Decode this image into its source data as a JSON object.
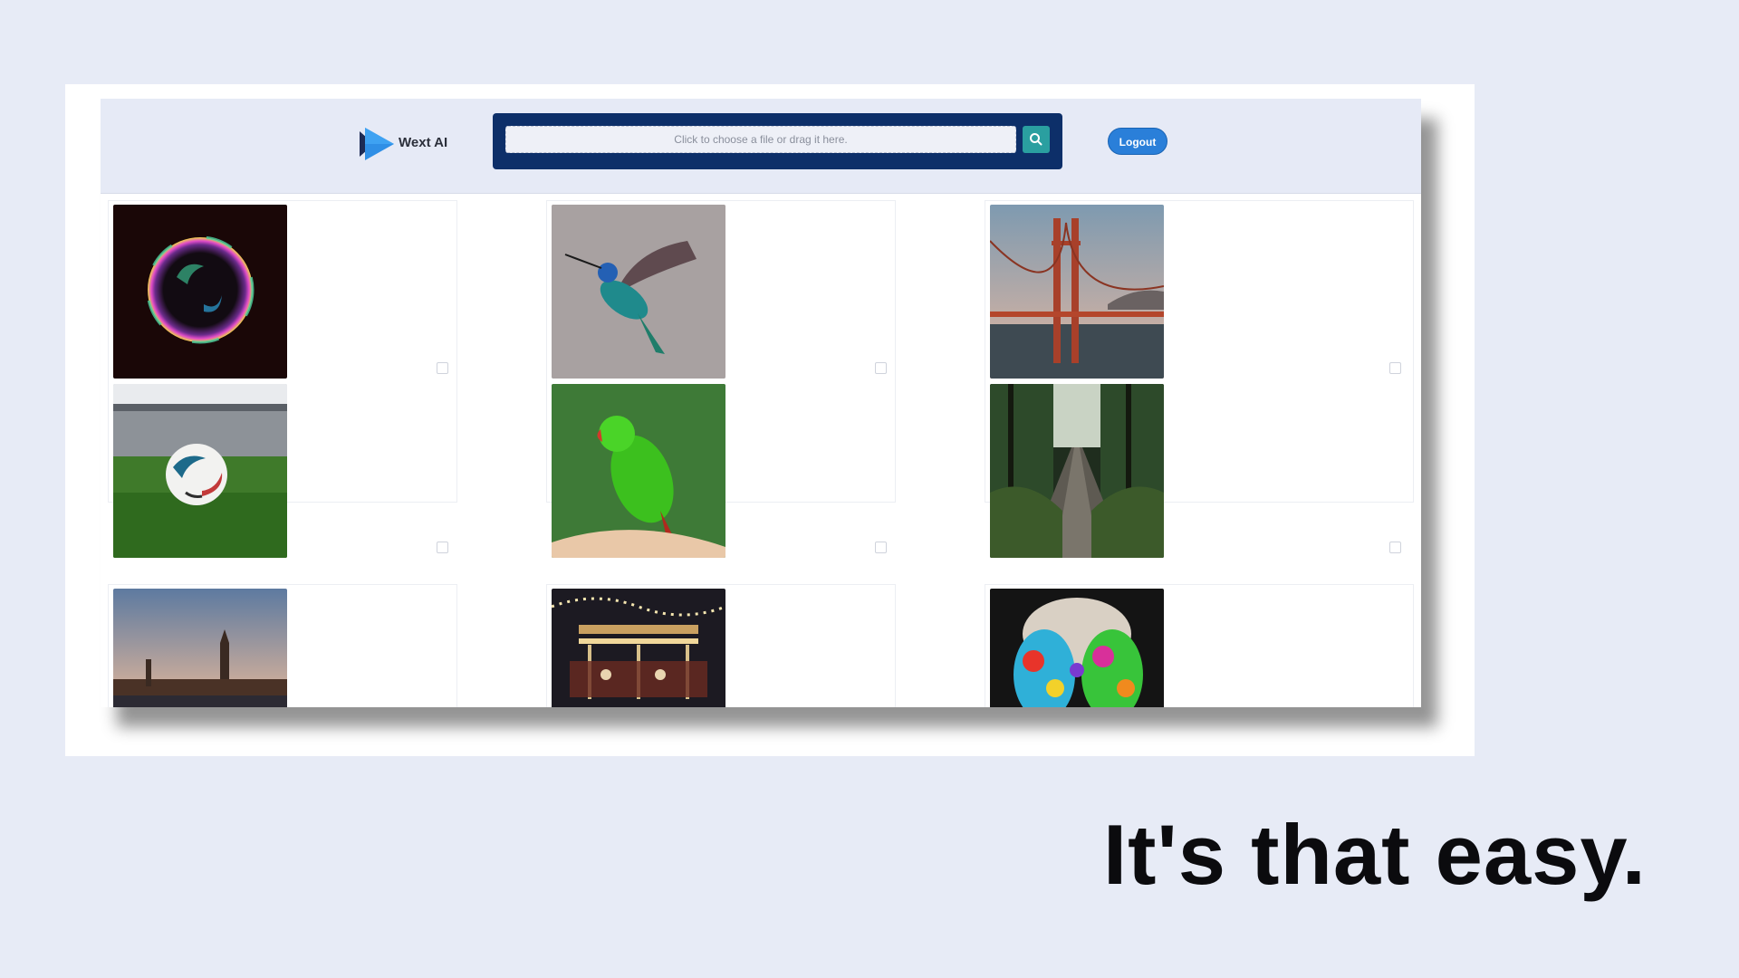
{
  "header": {
    "brand": "Wext AI",
    "search": {
      "placeholder": "Click to choose a file or drag it here.",
      "value": ""
    },
    "logout_label": "Logout"
  },
  "gallery": {
    "images": [
      {
        "subject": "bubble"
      },
      {
        "subject": "hummingbird"
      },
      {
        "subject": "golden-gate-bridge"
      },
      {
        "subject": "soccer-ball"
      },
      {
        "subject": "parrot"
      },
      {
        "subject": "forest-boardwalk"
      },
      {
        "subject": "london-skyline"
      },
      {
        "subject": "carousel"
      },
      {
        "subject": "painted-hands"
      }
    ]
  },
  "tagline": "It's that easy.",
  "colors": {
    "background": "#e7ebf6",
    "header_bg": "#e6eaf6",
    "search_frame": "#0d2f69",
    "search_button": "#2a9fa0",
    "logout_button": "#2a7fd9"
  }
}
